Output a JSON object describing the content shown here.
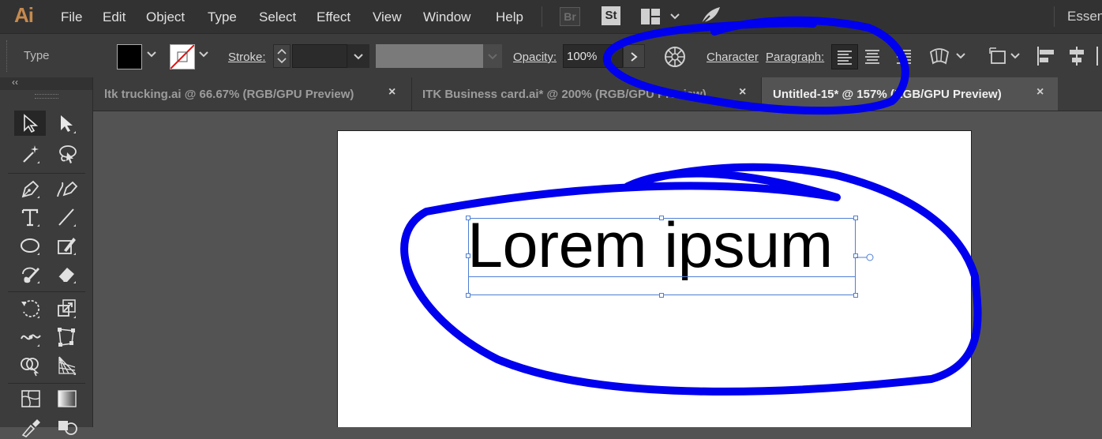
{
  "app": {
    "logo": "Ai"
  },
  "menu": [
    "File",
    "Edit",
    "Object",
    "Type",
    "Select",
    "Effect",
    "View",
    "Window",
    "Help"
  ],
  "bridge": {
    "br_label": "Br",
    "st_label": "St"
  },
  "workspace": {
    "label": "Essen"
  },
  "control": {
    "type_label": "Type",
    "stroke_label": "Stroke:",
    "opacity_label": "Opacity:",
    "opacity_value": "100%",
    "character_label": "Character",
    "paragraph_label": "Paragraph:",
    "fill_color": "#000000",
    "stroke_color": "none",
    "paragraph_alignment": "left"
  },
  "tabs": [
    {
      "title": "ltk trucking.ai @ 66.67% (RGB/GPU Preview)",
      "close": "×",
      "active": false
    },
    {
      "title": "ITK Business card.ai* @ 200% (RGB/GPU Preview)",
      "close": "×",
      "active": false
    },
    {
      "title": "Untitled-15* @ 157% (RGB/GPU Preview)",
      "close": "×",
      "active": true
    }
  ],
  "toolpanel": {
    "collapse": "‹‹"
  },
  "tools": [
    "selection-tool",
    "direct-selection-tool",
    "magic-wand-tool",
    "lasso-tool",
    "pen-tool",
    "curvature-tool",
    "type-tool",
    "line-segment-tool",
    "ellipse-tool",
    "shaper-tool",
    "paintbrush-tool",
    "eraser-tool",
    "rotate-tool",
    "scale-tool",
    "width-tool",
    "free-transform-tool",
    "shape-builder-tool",
    "perspective-grid-tool",
    "mesh-tool",
    "gradient-tool",
    "eyedropper-tool",
    "blend-tool"
  ],
  "artboard": {
    "text": "Lorem ipsum"
  },
  "annotation": {
    "color": "#0000ee"
  }
}
